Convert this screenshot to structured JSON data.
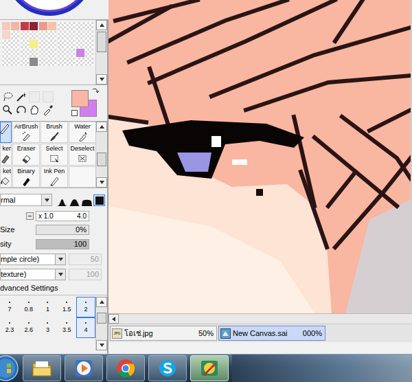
{
  "palette": {
    "swatches": [
      "#f7c9b9",
      "#f2b6a4",
      "#c6394d",
      "#8f2233",
      "#ef9a86",
      "#f8c2aa",
      "",
      "",
      "",
      "",
      "#f5d6c8",
      "",
      "",
      "",
      "",
      "",
      "",
      "",
      "",
      "",
      "",
      "",
      "",
      "#f6ee86",
      "",
      "",
      "",
      "",
      "",
      "",
      "",
      "",
      "",
      "",
      "",
      "",
      "",
      "",
      "#c784e2",
      "",
      "",
      "",
      "",
      "#8a8a8a",
      "",
      "",
      "",
      "",
      "",
      ""
    ]
  },
  "colors": {
    "primary": "#f9b6a2",
    "secondary": "#d27ef1"
  },
  "tools": [
    {
      "label": "",
      "selected": true
    },
    {
      "label": "AirBrush",
      "selected": false
    },
    {
      "label": "Brush",
      "selected": false
    },
    {
      "label": "Water",
      "selected": false
    },
    {
      "label": "ker",
      "selected": false
    },
    {
      "label": "Eraser",
      "selected": false
    },
    {
      "label": "Select",
      "selected": false
    },
    {
      "label": "Deselect",
      "selected": false
    },
    {
      "label": "ket",
      "selected": false
    },
    {
      "label": "Binary",
      "selected": false
    },
    {
      "label": "Ink Pen",
      "selected": false
    },
    {
      "label": "",
      "selected": false
    }
  ],
  "blend_mode": {
    "value": "rmal"
  },
  "brush_shapes": [
    {
      "selected": false
    },
    {
      "selected": false
    },
    {
      "selected": false
    },
    {
      "selected": true
    }
  ],
  "size": {
    "multiplier": "x 1.0",
    "value": "4.0"
  },
  "min_size": {
    "label": "Size",
    "value": "0%",
    "level": 0
  },
  "density": {
    "label": "sity",
    "value": "100",
    "level": 1
  },
  "shape": {
    "label": "mple circle)",
    "value": "50"
  },
  "texture": {
    "label": "texture)",
    "value": "100"
  },
  "advanced_settings": {
    "label": "dvanced Settings"
  },
  "brush_sizes": [
    {
      "label": "7",
      "selected": false
    },
    {
      "label": "0.8",
      "selected": false
    },
    {
      "label": "1",
      "selected": false
    },
    {
      "label": "1.5",
      "selected": false
    },
    {
      "label": "2",
      "selected": true
    },
    {
      "label": "2.3",
      "selected": false
    },
    {
      "label": "2.6",
      "selected": false
    },
    {
      "label": "3",
      "selected": false
    },
    {
      "label": "3.5",
      "selected": false
    },
    {
      "label": "4",
      "selected": true
    }
  ],
  "document_tabs": [
    {
      "label": "โอเช่.jpg",
      "zoom": "50%",
      "selected": false,
      "kind": "jpg",
      "badge": "JPG"
    },
    {
      "label": "New Canvas.sai",
      "zoom": "000%",
      "selected": true,
      "kind": "sai",
      "badge": ""
    }
  ],
  "taskbar": {
    "apps": [
      {
        "kind": "explorer",
        "selected": false
      },
      {
        "kind": "media",
        "selected": false
      },
      {
        "kind": "chrome",
        "selected": false
      },
      {
        "kind": "skype",
        "selected": false
      },
      {
        "kind": "sai",
        "selected": true
      }
    ]
  }
}
